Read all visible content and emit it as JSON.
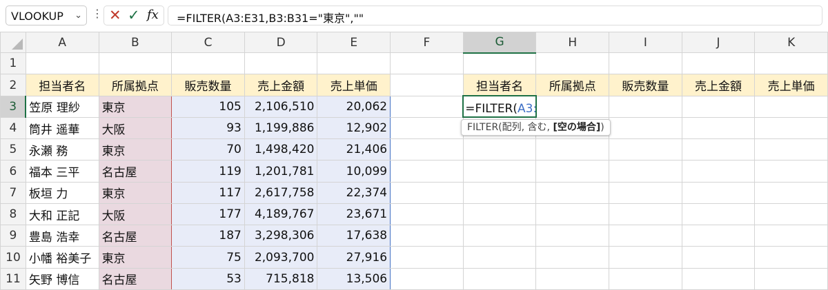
{
  "namebox": {
    "value": "VLOOKUP"
  },
  "formula_bar": {
    "more": "⋮",
    "cancel": "✕",
    "enter": "✓",
    "fx": "fx",
    "formula": "=FILTER(A3:E31,B3:B31=\"東京\",\"\""
  },
  "columns": [
    "A",
    "B",
    "C",
    "D",
    "E",
    "F",
    "G",
    "H",
    "I",
    "J",
    "K"
  ],
  "rows": [
    "1",
    "2",
    "3",
    "4",
    "5",
    "6",
    "7",
    "8",
    "9",
    "10",
    "11"
  ],
  "table_headers": [
    "担当者名",
    "所属拠点",
    "販売数量",
    "売上金額",
    "売上単価"
  ],
  "data_rows": [
    [
      "笠原 理紗",
      "東京",
      "105",
      "2,106,510",
      "20,062"
    ],
    [
      "筒井 遥華",
      "大阪",
      "93",
      "1,199,886",
      "12,902"
    ],
    [
      "永瀬 務",
      "東京",
      "70",
      "1,498,420",
      "21,406"
    ],
    [
      "福本 三平",
      "名古屋",
      "119",
      "1,201,781",
      "10,099"
    ],
    [
      "板垣 力",
      "東京",
      "117",
      "2,617,758",
      "22,374"
    ],
    [
      "大和 正記",
      "大阪",
      "177",
      "4,189,767",
      "23,671"
    ],
    [
      "豊島 浩幸",
      "名古屋",
      "187",
      "3,298,306",
      "17,638"
    ],
    [
      "小幡 裕美子",
      "東京",
      "75",
      "2,093,700",
      "27,916"
    ],
    [
      "矢野 博信",
      "名古屋",
      "53",
      "715,818",
      "13,506"
    ]
  ],
  "right_headers": [
    "担当者名",
    "所属拠点",
    "販売数量",
    "売上金額",
    "売上単価"
  ],
  "edit": {
    "prefix": "=FILTER(",
    "ref_a": "A3:E31",
    "comma1": ",",
    "ref_b": "B3:B31",
    "rest": "=\"東京\",\"\""
  },
  "tooltip": {
    "func": "FILTER(配列, 含む, ",
    "bold_arg": "[空の場合]",
    "close": ")"
  }
}
